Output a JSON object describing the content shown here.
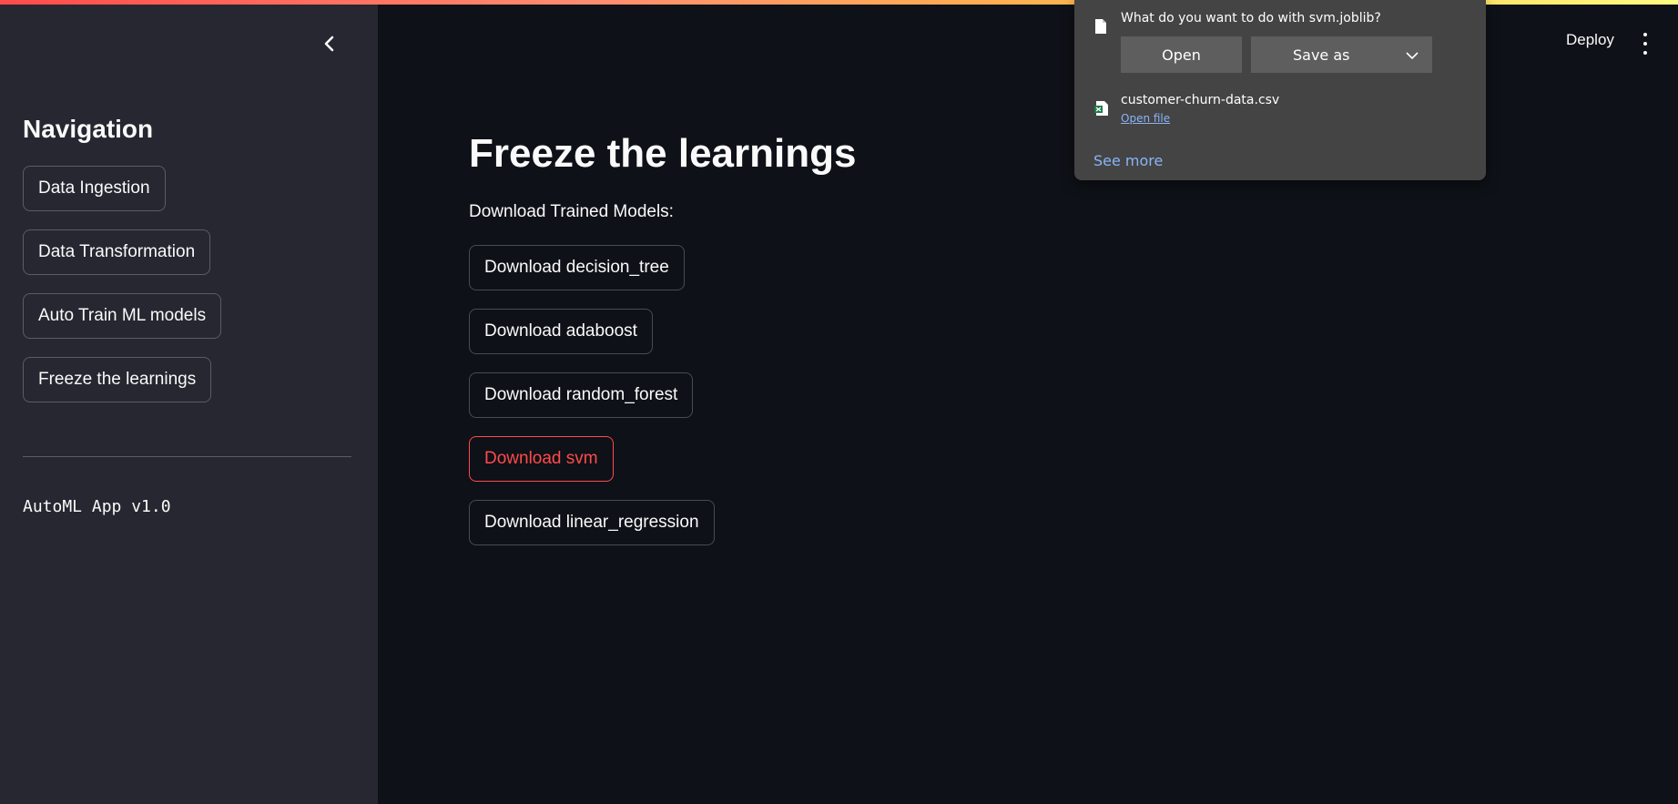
{
  "sidebar": {
    "title": "Navigation",
    "items": [
      {
        "label": "Data Ingestion"
      },
      {
        "label": "Data Transformation"
      },
      {
        "label": "Auto Train ML models"
      },
      {
        "label": "Freeze the learnings"
      }
    ],
    "version": "AutoML App v1.0"
  },
  "header": {
    "deploy_label": "Deploy"
  },
  "main": {
    "title": "Freeze the learnings",
    "subtitle": "Download Trained Models:",
    "buttons": [
      {
        "label": "Download decision_tree"
      },
      {
        "label": "Download adaboost"
      },
      {
        "label": "Download random_forest"
      },
      {
        "label": "Download svm",
        "state": "active"
      },
      {
        "label": "Download linear_regression"
      }
    ]
  },
  "download_popup": {
    "question": "What do you want to do with svm.joblib?",
    "open_label": "Open",
    "save_as_label": "Save as",
    "recent_file": "customer-churn-data.csv",
    "recent_action": "Open file",
    "see_more": "See more"
  },
  "colors": {
    "background": "#0e1117",
    "sidebar": "#262730",
    "accent": "#ff4b4b",
    "popup": "#444444",
    "link": "#8ab4f8"
  },
  "icons": [
    "chevron-left-icon",
    "kebab-menu-icon",
    "file-icon",
    "chevron-down-icon",
    "excel-file-icon"
  ]
}
